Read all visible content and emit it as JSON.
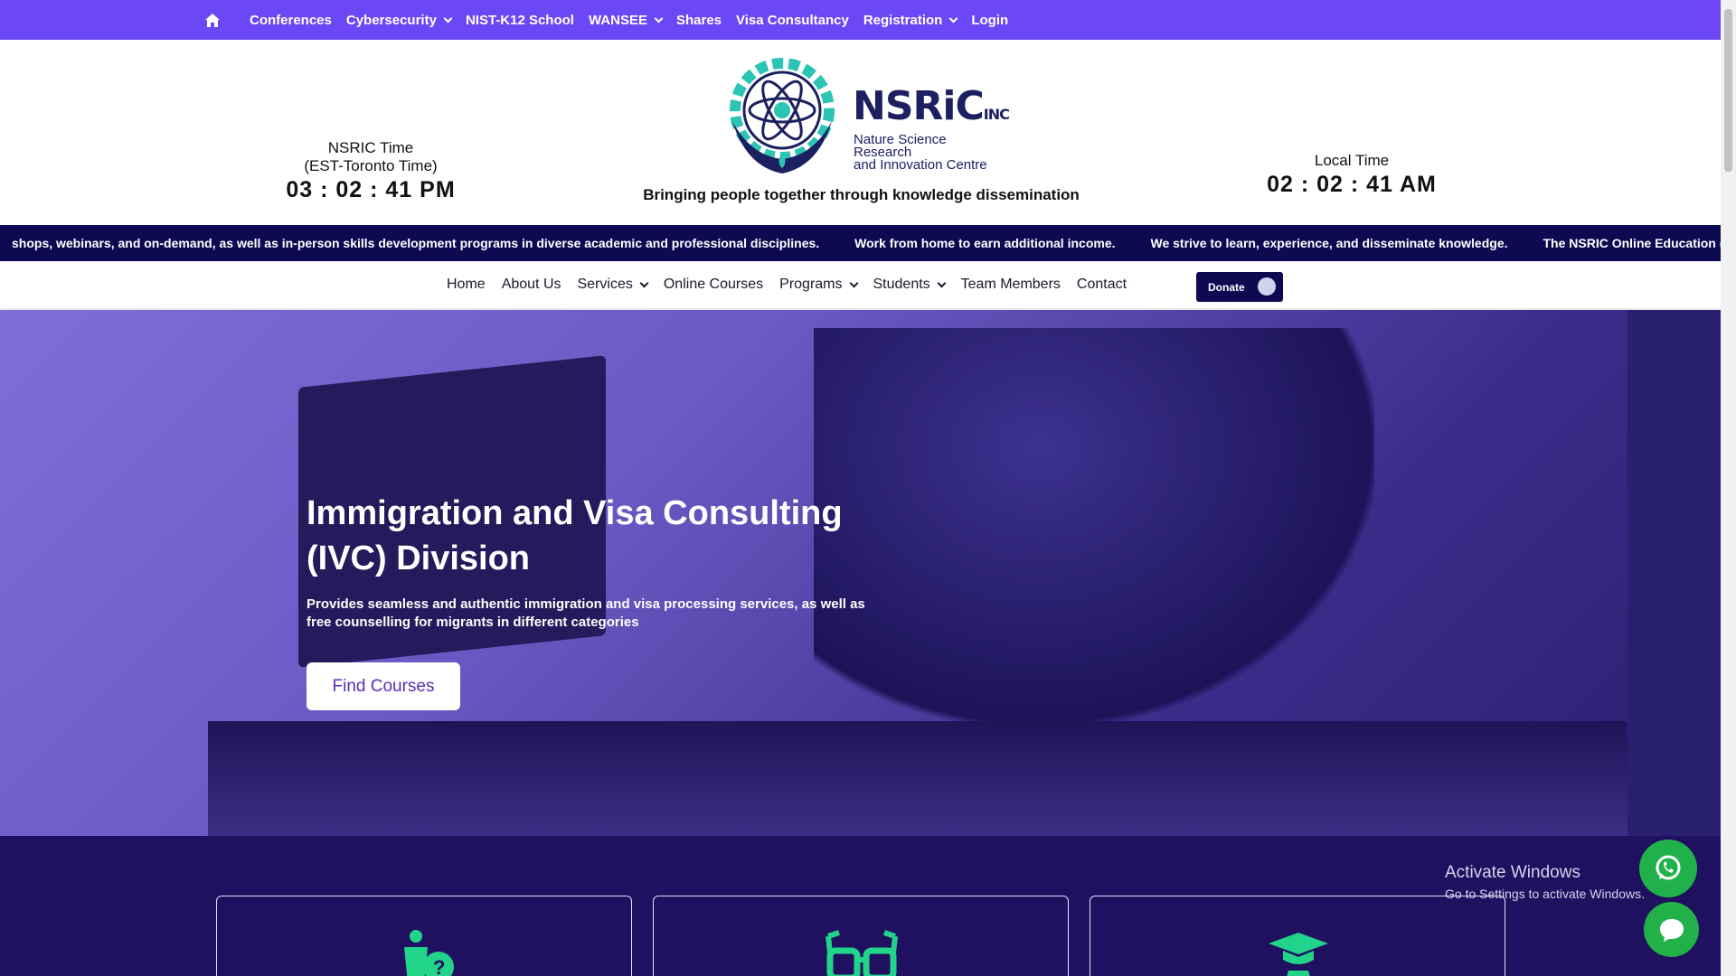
{
  "topbar": {
    "items": [
      {
        "label": "Conferences",
        "dropdown": false
      },
      {
        "label": "Cybersecurity",
        "dropdown": true
      },
      {
        "label": "NIST-K12 School",
        "dropdown": false
      },
      {
        "label": "WANSEE",
        "dropdown": true
      },
      {
        "label": "Shares",
        "dropdown": false
      },
      {
        "label": "Visa Consultancy",
        "dropdown": false
      },
      {
        "label": "Registration",
        "dropdown": true
      },
      {
        "label": "Login",
        "dropdown": false
      }
    ],
    "color": "#6b47f5"
  },
  "header": {
    "left_clock": {
      "label1": "NSRIC Time",
      "label2": "(EST-Toronto Time)",
      "time": "03 : 02 : 41 PM"
    },
    "right_clock": {
      "label": "Local Time",
      "time": "02 : 02 : 41 AM"
    },
    "logo": {
      "brand": "NSRiC",
      "suffix": "INC",
      "sub1": "Nature Science Research",
      "sub2": "and Innovation Centre"
    },
    "tagline": "Bringing people together through knowledge dissemination"
  },
  "ticker": {
    "items": [
      "shops, webinars, and on-demand, as well as in-person skills development programs in diverse academic and professional disciplines.",
      "Work from home to earn additional income.",
      "We strive to learn, experience, and disseminate knowledge.",
      "The NSRIC Online Education (OE) Division is cc"
    ]
  },
  "mainnav": {
    "items": [
      {
        "label": "Home",
        "dropdown": false
      },
      {
        "label": "About Us",
        "dropdown": false
      },
      {
        "label": "Services",
        "dropdown": true
      },
      {
        "label": "Online Courses",
        "dropdown": false
      },
      {
        "label": "Programs",
        "dropdown": true
      },
      {
        "label": "Students",
        "dropdown": true
      },
      {
        "label": "Team Members",
        "dropdown": false
      },
      {
        "label": "Contact",
        "dropdown": false
      }
    ],
    "donate_label": "Donate"
  },
  "hero": {
    "title_line1": "Immigration and Visa Consulting",
    "title_line2": "(IVC) Division",
    "description": "Provides seamless and authentic immigration and visa processing services, as well as free counselling for migrants in different categories",
    "button_label": "Find Courses"
  },
  "features": {
    "cards": [
      {
        "icon": "person-question-icon"
      },
      {
        "icon": "glasses-icon"
      },
      {
        "icon": "graduate-icon"
      }
    ],
    "accent": "#22d38a"
  },
  "watermark": {
    "line1": "Activate Windows",
    "line2": "Go to Settings to activate Windows."
  },
  "fabs": {
    "whatsapp": "whatsapp-icon",
    "chat": "chat-bubble-icon"
  }
}
